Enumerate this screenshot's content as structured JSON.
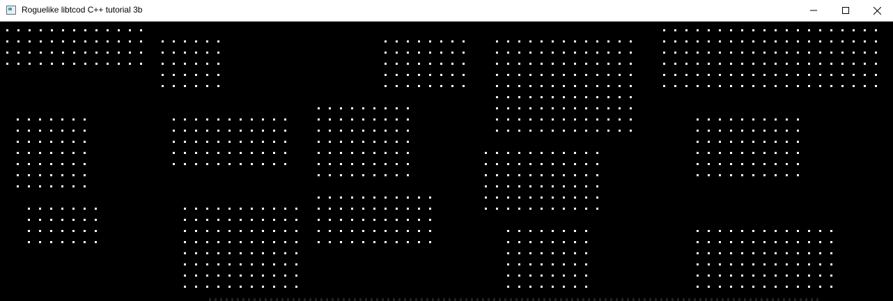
{
  "window": {
    "title": "Roguelike libtcod C++ tutorial 3b",
    "icon": "console-app-icon",
    "controls": [
      "minimize-icon",
      "maximize-icon",
      "close-icon"
    ]
  },
  "map": {
    "floor_glyph": ".",
    "floor_color": "#ffffff",
    "background_color": "#000000"
  }
}
